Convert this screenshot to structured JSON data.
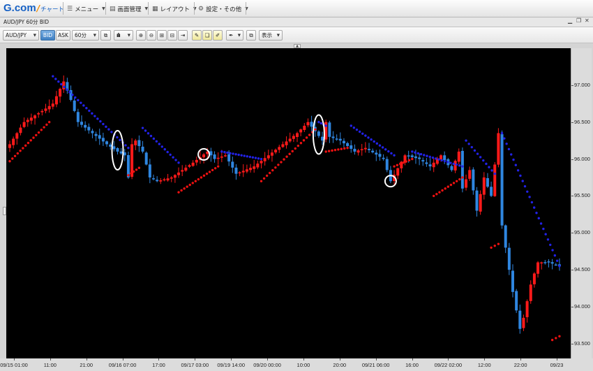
{
  "topbar": {
    "logo_g": "G.com",
    "logo_chart": "チャート",
    "menu": "メニュー",
    "screen": "画面管理",
    "layout": "レイアウト",
    "settings": "設定・その他"
  },
  "window": {
    "title": "AUD/JPY 60分 BID"
  },
  "toolbar": {
    "pair": "AUD/JPY",
    "bid": "BID",
    "ask": "ASK",
    "timeframe": "60分",
    "display": "表示"
  },
  "colors": {
    "up": "#ff1a1a",
    "down": "#2f86e0",
    "sar_above": "#2222e6",
    "sar_below": "#ee1111",
    "background": "#000000"
  },
  "chart_data": {
    "type": "candlestick",
    "instrument": "AUD/JPY",
    "interval": "60分",
    "price_type": "BID",
    "ylim": [
      93.3,
      97.5
    ],
    "y_ticks": [
      "93.500",
      "94.000",
      "94.500",
      "95.000",
      "95.500",
      "96.000",
      "96.500",
      "97.000"
    ],
    "x_ticks": [
      "09/15 01:00",
      "11:00",
      "21:00",
      "09/16 07:00",
      "17:00",
      "09/17 03:00",
      "09/19 14:00",
      "09/20 00:00",
      "10:00",
      "20:00",
      "09/21 06:00",
      "16:00",
      "09/22 02:00",
      "12:00",
      "22:00",
      "09/23"
    ],
    "close_path": [
      [
        0,
        96.2
      ],
      [
        4,
        96.5
      ],
      [
        9,
        96.65
      ],
      [
        12,
        96.75
      ],
      [
        14,
        96.95
      ],
      [
        15,
        97.05
      ],
      [
        17,
        96.8
      ],
      [
        19,
        96.5
      ],
      [
        23,
        96.35
      ],
      [
        27,
        96.2
      ],
      [
        30,
        96.1
      ],
      [
        32,
        96.05
      ],
      [
        33,
        95.75
      ],
      [
        34,
        96.2
      ],
      [
        35,
        96.25
      ],
      [
        37,
        96.1
      ],
      [
        39,
        95.75
      ],
      [
        41,
        95.7
      ],
      [
        45,
        95.75
      ],
      [
        48,
        95.85
      ],
      [
        51,
        95.95
      ],
      [
        55,
        96.1
      ],
      [
        57,
        96.0
      ],
      [
        60,
        96.05
      ],
      [
        63,
        95.8
      ],
      [
        68,
        95.9
      ],
      [
        72,
        96.05
      ],
      [
        76,
        96.2
      ],
      [
        80,
        96.35
      ],
      [
        83,
        96.5
      ],
      [
        87,
        96.25
      ],
      [
        88,
        96.5
      ],
      [
        89,
        96.3
      ],
      [
        92,
        96.25
      ],
      [
        96,
        96.1
      ],
      [
        99,
        96.15
      ],
      [
        104,
        96.0
      ],
      [
        106,
        95.7
      ],
      [
        110,
        96.05
      ],
      [
        114,
        96.0
      ],
      [
        117,
        95.9
      ],
      [
        120,
        96.05
      ],
      [
        123,
        95.85
      ],
      [
        125,
        96.1
      ],
      [
        126,
        95.6
      ],
      [
        128,
        95.85
      ],
      [
        130,
        95.3
      ],
      [
        132,
        95.75
      ],
      [
        134,
        95.5
      ],
      [
        136,
        96.35
      ],
      [
        137,
        95.1
      ],
      [
        138,
        94.8
      ],
      [
        140,
        94.2
      ],
      [
        142,
        93.7
      ],
      [
        143,
        93.85
      ],
      [
        145,
        94.3
      ],
      [
        147,
        94.6
      ],
      [
        150,
        94.6
      ],
      [
        153,
        94.55
      ]
    ],
    "sar": [
      {
        "side": "below",
        "from": [
          0,
          95.97
        ],
        "to": [
          11,
          96.5
        ],
        "count": 16
      },
      {
        "side": "above",
        "from": [
          12,
          97.12
        ],
        "to": [
          33,
          96.15
        ],
        "count": 28
      },
      {
        "side": "below",
        "from": [
          33,
          95.78
        ],
        "to": [
          36,
          95.88
        ],
        "count": 5
      },
      {
        "side": "above",
        "from": [
          37,
          96.42
        ],
        "to": [
          47,
          95.95
        ],
        "count": 14
      },
      {
        "side": "below",
        "from": [
          47,
          95.55
        ],
        "to": [
          58,
          95.9
        ],
        "count": 15
      },
      {
        "side": "above",
        "from": [
          59,
          96.1
        ],
        "to": [
          70,
          96.0
        ],
        "count": 15
      },
      {
        "side": "below",
        "from": [
          70,
          95.7
        ],
        "to": [
          85,
          96.4
        ],
        "count": 20
      },
      {
        "side": "above",
        "from": [
          86,
          96.5
        ],
        "to": [
          88,
          96.45
        ],
        "count": 4
      },
      {
        "side": "below",
        "from": [
          88,
          96.1
        ],
        "to": [
          94,
          96.15
        ],
        "count": 8
      },
      {
        "side": "above",
        "from": [
          95,
          96.45
        ],
        "to": [
          107,
          96.05
        ],
        "count": 16
      },
      {
        "side": "below",
        "from": [
          107,
          95.9
        ],
        "to": [
          112,
          96.0
        ],
        "count": 7
      },
      {
        "side": "above",
        "from": [
          112,
          96.1
        ],
        "to": [
          126,
          95.9
        ],
        "count": 18
      },
      {
        "side": "below",
        "from": [
          118,
          95.5
        ],
        "to": [
          126,
          95.75
        ],
        "count": 11
      },
      {
        "side": "above",
        "from": [
          127,
          96.25
        ],
        "to": [
          135,
          95.8
        ],
        "count": 11
      },
      {
        "side": "below",
        "from": [
          134,
          94.8
        ],
        "to": [
          136,
          94.85
        ],
        "count": 3
      },
      {
        "side": "above",
        "from": [
          137,
          96.35
        ],
        "to": [
          153,
          94.55
        ],
        "count": 26
      },
      {
        "side": "below",
        "from": [
          151,
          93.55
        ],
        "to": [
          153,
          93.6
        ],
        "count": 3
      }
    ],
    "highlights": [
      {
        "index": 30,
        "shape": "tall-ellipse"
      },
      {
        "index": 54,
        "shape": "circle"
      },
      {
        "index": 86,
        "shape": "tall-ellipse"
      },
      {
        "index": 106,
        "shape": "circle"
      }
    ]
  }
}
